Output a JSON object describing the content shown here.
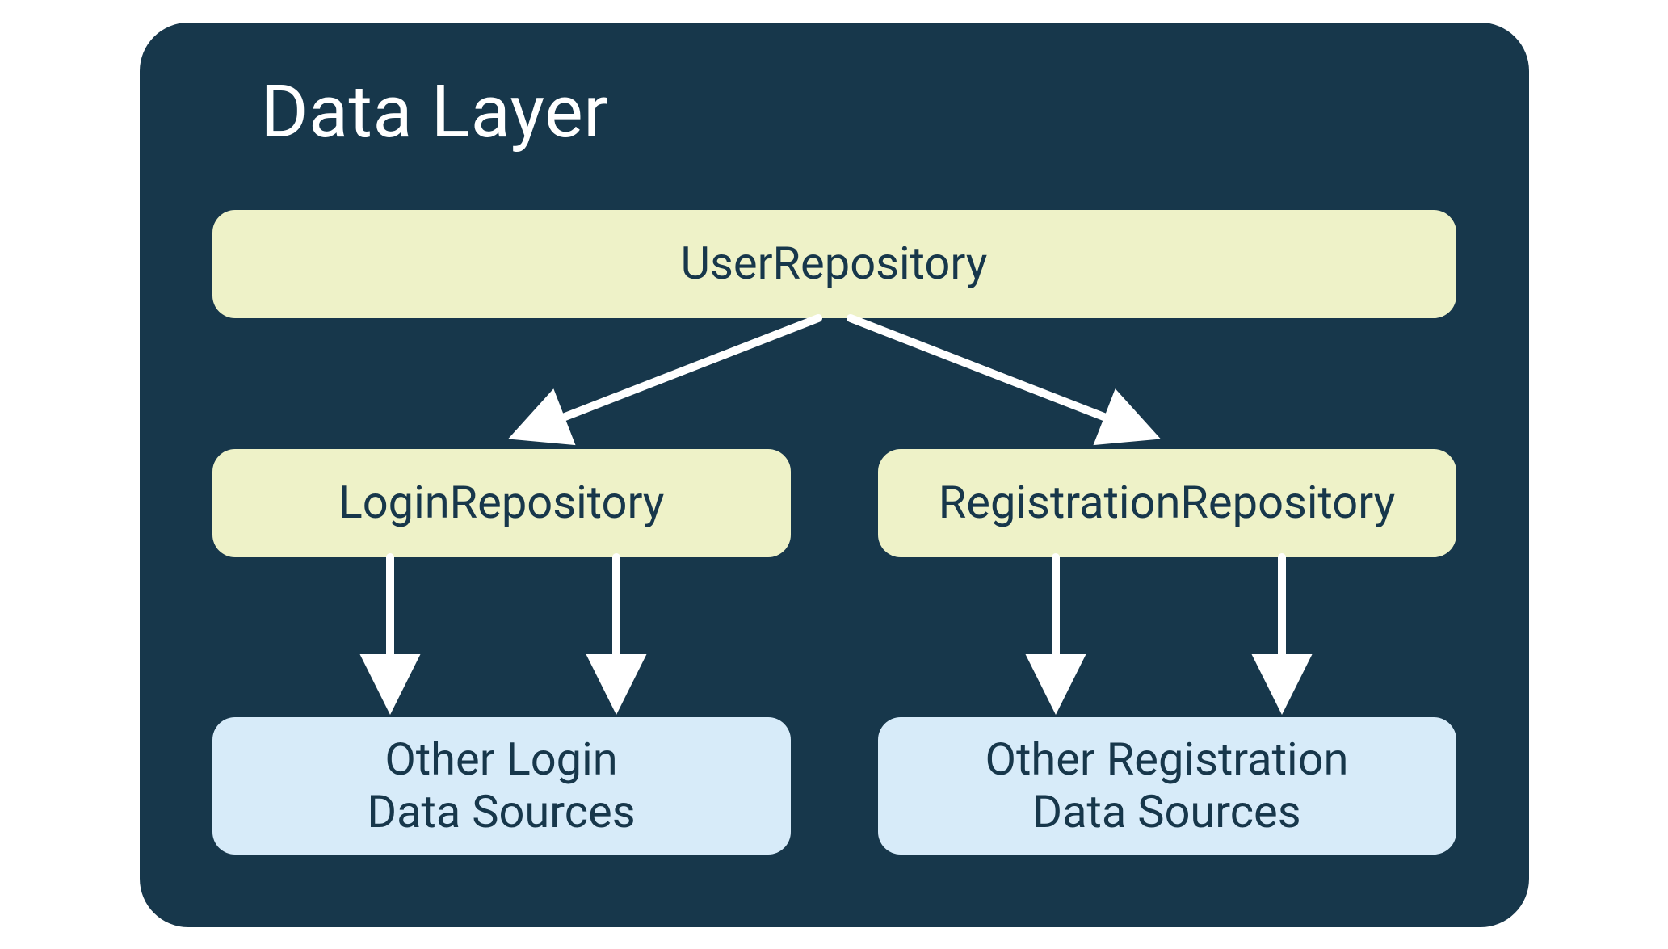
{
  "title": "Data Layer",
  "nodes": {
    "user_repository": "UserRepository",
    "login_repository": "LoginRepository",
    "registration_repository": "RegistrationRepository",
    "login_data_sources": "Other Login\nData Sources",
    "registration_data_sources": "Other Registration\nData Sources"
  },
  "colors": {
    "panel_bg": "#17374b",
    "node_green": "#eef2c8",
    "node_blue": "#d7ebf9",
    "text_dark": "#17374b",
    "text_light": "#ffffff",
    "arrow": "#ffffff"
  },
  "edges": [
    {
      "from": "user_repository",
      "to": "login_repository"
    },
    {
      "from": "user_repository",
      "to": "registration_repository"
    },
    {
      "from": "login_repository",
      "to": "login_data_sources"
    },
    {
      "from": "login_repository",
      "to": "login_data_sources"
    },
    {
      "from": "registration_repository",
      "to": "registration_data_sources"
    },
    {
      "from": "registration_repository",
      "to": "registration_data_sources"
    }
  ]
}
